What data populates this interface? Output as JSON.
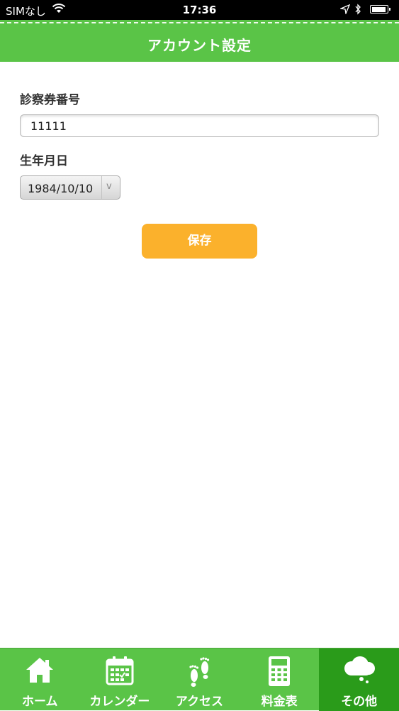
{
  "status_bar": {
    "carrier": "SIMなし",
    "time": "17:36",
    "battery_level": 0.95
  },
  "header": {
    "title": "アカウント設定"
  },
  "form": {
    "ticket_number_label": "診察券番号",
    "ticket_number_value": "11111",
    "birthdate_label": "生年月日",
    "birthdate_value": "1984/10/10",
    "save_label": "保存"
  },
  "tabs": [
    {
      "label": "ホーム",
      "icon": "home-icon",
      "active": false
    },
    {
      "label": "カレンダー",
      "icon": "calendar-icon",
      "active": false
    },
    {
      "label": "アクセス",
      "icon": "footprints-icon",
      "active": false
    },
    {
      "label": "料金表",
      "icon": "calculator-icon",
      "active": false
    },
    {
      "label": "その他",
      "icon": "cloud-icon",
      "active": true
    }
  ],
  "colors": {
    "brand_green": "#5ac447",
    "active_tab": "#2a9b1a",
    "save_orange": "#fbb12c"
  }
}
